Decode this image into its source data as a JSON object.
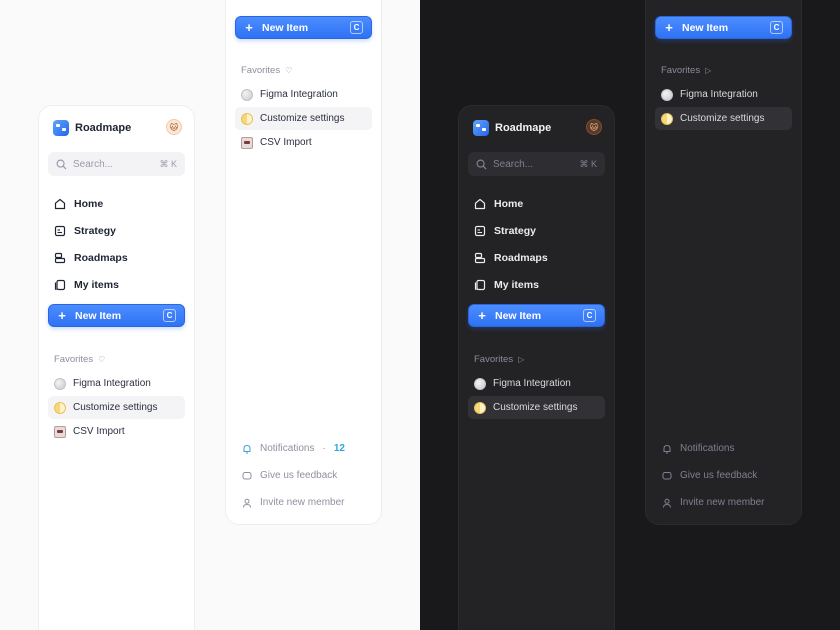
{
  "brand": {
    "name": "Roadmape"
  },
  "search": {
    "placeholder": "Search...",
    "shortcut": "⌘ K"
  },
  "nav": [
    {
      "label": "Home",
      "icon": "home-icon"
    },
    {
      "label": "Strategy",
      "icon": "strategy-icon"
    },
    {
      "label": "Roadmaps",
      "icon": "roadmaps-icon"
    },
    {
      "label": "My items",
      "icon": "my-items-icon"
    }
  ],
  "new_item": {
    "label": "New Item",
    "shortcut": "C"
  },
  "favorites": {
    "title": "Favorites",
    "items": [
      {
        "label": "Figma Integration",
        "icon": "figma-dot-icon"
      },
      {
        "label": "Customize settings",
        "icon": "settings-dot-icon",
        "active": true
      },
      {
        "label": "CSV Import",
        "icon": "robot-icon"
      }
    ]
  },
  "footer": {
    "notifications": "Notifications",
    "notifications_sep": "·",
    "notifications_count": "12",
    "feedback": "Give us feedback",
    "invite": "Invite new member"
  },
  "colors": {
    "accent": "#3b82f6",
    "light_bg": "#fafafa",
    "dark_bg": "#19191b",
    "dark_panel": "#232326",
    "badge": "#2ba7e0"
  }
}
